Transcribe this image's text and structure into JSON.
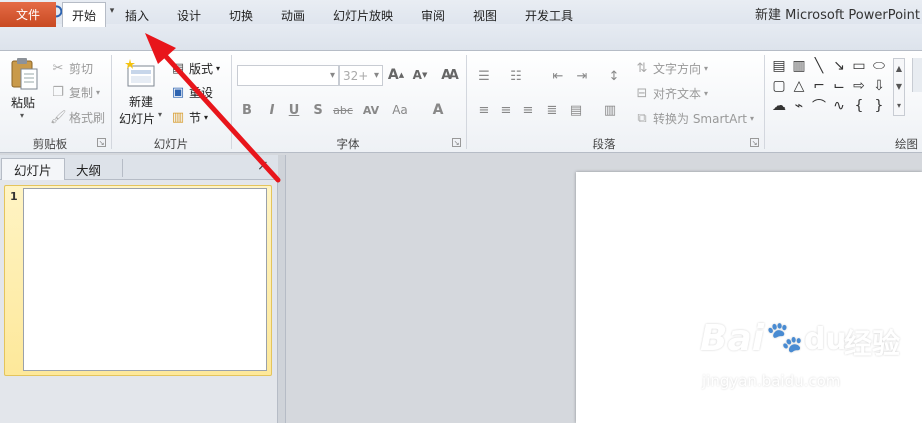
{
  "window": {
    "title": "新建 Microsoft PowerPoint"
  },
  "app_logo": "P",
  "ribbon_tabs": [
    {
      "label": "文件"
    },
    {
      "label": "开始"
    },
    {
      "label": "插入"
    },
    {
      "label": "设计"
    },
    {
      "label": "切换"
    },
    {
      "label": "动画"
    },
    {
      "label": "幻灯片放映"
    },
    {
      "label": "审阅"
    },
    {
      "label": "视图"
    },
    {
      "label": "开发工具"
    }
  ],
  "clipboard": {
    "paste": "粘贴",
    "cut": "剪切",
    "copy": "复制",
    "format_painter": "格式刷",
    "label": "剪贴板"
  },
  "slides_group": {
    "new_slide_line1": "新建",
    "new_slide_line2": "幻灯片",
    "layout": "版式",
    "reset": "重设",
    "section": "节",
    "label": "幻灯片"
  },
  "font_group": {
    "size": "32+",
    "bold": "B",
    "italic": "I",
    "underline": "U",
    "shadow": "S",
    "strike": "abc",
    "spacing": "AV",
    "case": "Aa",
    "color": "A",
    "label": "字体"
  },
  "paragraph_group": {
    "text_direction": "文字方向",
    "align_text": "对齐文本",
    "convert_smartart": "转换为 SmartArt",
    "label": "段落"
  },
  "drawing_group": {
    "label": "绘图"
  },
  "pane": {
    "tab_slides": "幻灯片",
    "tab_outline": "大纲",
    "close": "×",
    "slide_number": "1"
  },
  "watermark": {
    "brand": "Bai",
    "brand2": "du",
    "cn": "经验",
    "url": "jingyan.baidu.com"
  },
  "colors": {
    "accent_file": "#d24726",
    "arrow": "#e8151b",
    "thumb_highlight": "#fde89a"
  }
}
